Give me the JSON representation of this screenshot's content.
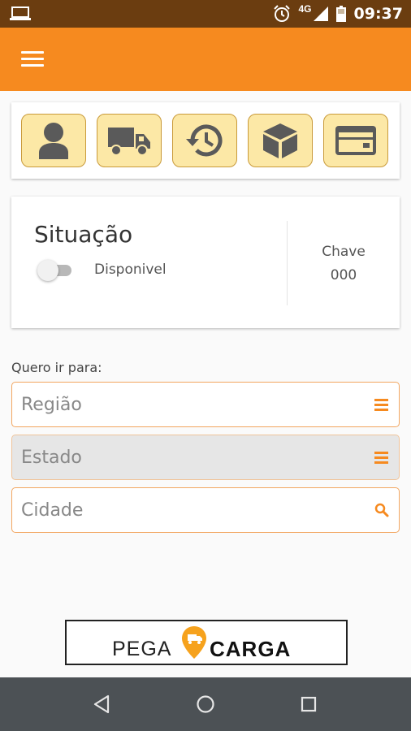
{
  "status_bar": {
    "network": "4G",
    "time": "09:37"
  },
  "app_bar": {
    "menu_icon": "hamburger-menu-icon",
    "color": "#f68a1f"
  },
  "shortcut_tiles": [
    {
      "icon": "person-icon"
    },
    {
      "icon": "truck-icon"
    },
    {
      "icon": "history-icon"
    },
    {
      "icon": "package-icon"
    },
    {
      "icon": "credit-card-icon"
    }
  ],
  "status_card": {
    "title": "Situação",
    "toggle_label": "Disponivel",
    "toggle_on": false,
    "key_label": "Chave",
    "key_value": "000"
  },
  "destination": {
    "label": "Quero ir para:",
    "fields": [
      {
        "placeholder": "Região",
        "icon": "list-icon",
        "disabled": false
      },
      {
        "placeholder": "Estado",
        "icon": "list-icon",
        "disabled": true
      },
      {
        "placeholder": "Cidade",
        "icon": "search-icon",
        "disabled": false
      }
    ]
  },
  "logo": {
    "left_text": "PEGA",
    "right_text": "CARGA",
    "accent": "#f6a21d"
  },
  "nav_bar": {
    "buttons": [
      "back-icon",
      "home-icon",
      "recents-icon"
    ]
  }
}
